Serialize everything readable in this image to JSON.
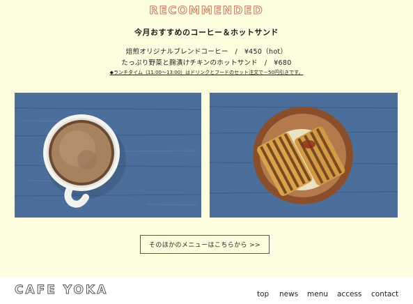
{
  "section": {
    "heading": "RECOMMENDED",
    "subtitle": "今月おすすめのコーヒー＆ホットサンド",
    "items": [
      "焙煎オリジナルブレンドコーヒー　/　¥450（hot）",
      "たっぷり野菜と麹漬けチキンのホットサンド　/　¥680"
    ],
    "note": "◆ランチタイム（11:00〜13:00）はドリンクとフードのセット注文で－50円引きです。",
    "images": [
      "coffee-cup-photo",
      "hot-sandwich-photo"
    ],
    "more_button": "そのほかのメニューはこちらから >>"
  },
  "footer": {
    "logo": "CAFE YOKA",
    "nav": [
      "top",
      "news",
      "menu",
      "access",
      "contact"
    ]
  },
  "colors": {
    "background": "#fcfcdf",
    "heading_outline": "#c8826a",
    "table_blue": "#4c6e9a"
  }
}
